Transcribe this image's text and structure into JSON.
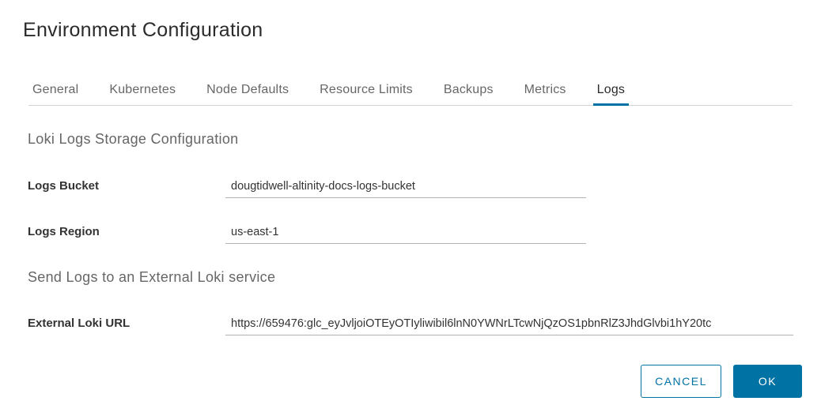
{
  "dialog": {
    "title": "Environment Configuration"
  },
  "tabs": [
    {
      "label": "General",
      "active": false
    },
    {
      "label": "Kubernetes",
      "active": false
    },
    {
      "label": "Node Defaults",
      "active": false
    },
    {
      "label": "Resource Limits",
      "active": false
    },
    {
      "label": "Backups",
      "active": false
    },
    {
      "label": "Metrics",
      "active": false
    },
    {
      "label": "Logs",
      "active": true
    }
  ],
  "loki_storage": {
    "heading": "Loki Logs Storage Configuration",
    "bucket_label": "Logs Bucket",
    "bucket_value": "dougtidwell-altinity-docs-logs-bucket",
    "region_label": "Logs Region",
    "region_value": "us-east-1"
  },
  "external_loki": {
    "heading": "Send Logs to an External Loki service",
    "url_label": "External Loki URL",
    "url_value": "https://659476:glc_eyJvljoiOTEyOTIyliwibil6lnN0YWNrLTcwNjQzOS1pbnRlZ3JhdGlvbi1hY20tc"
  },
  "buttons": {
    "cancel": "CANCEL",
    "ok": "OK"
  },
  "colors": {
    "accent": "#0072a3",
    "tab_border": "#d4d4d4"
  }
}
